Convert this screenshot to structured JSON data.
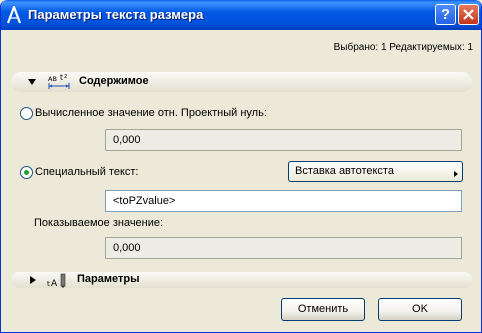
{
  "window": {
    "title": "Параметры текста размера"
  },
  "status": {
    "text": "Выбрано: 1 Редактируемых: 1"
  },
  "sections": {
    "content": {
      "title": "Содержимое"
    },
    "params": {
      "title": "Параметры"
    }
  },
  "calculated": {
    "label": "Вычисленное значение отн. Проектный нуль:",
    "value": "0,000",
    "checked": false
  },
  "custom": {
    "label": "Специальный текст:",
    "value": "<toPZvalue>",
    "checked": true
  },
  "autotext": {
    "label": "Вставка автотекста"
  },
  "displayed": {
    "label": "Показываемое значение:",
    "value": "0,000"
  },
  "buttons": {
    "cancel": "Отменить",
    "ok": "OK"
  },
  "colors": {
    "titlebar": "#0058e6",
    "radio_dot": "#21a121",
    "dialog_bg": "#ece9d8"
  },
  "icons": {
    "app": "archicad-icon",
    "help": "help-icon",
    "close": "close-icon",
    "content_section": "dimension-text-icon",
    "params_section": "text-params-icon"
  }
}
